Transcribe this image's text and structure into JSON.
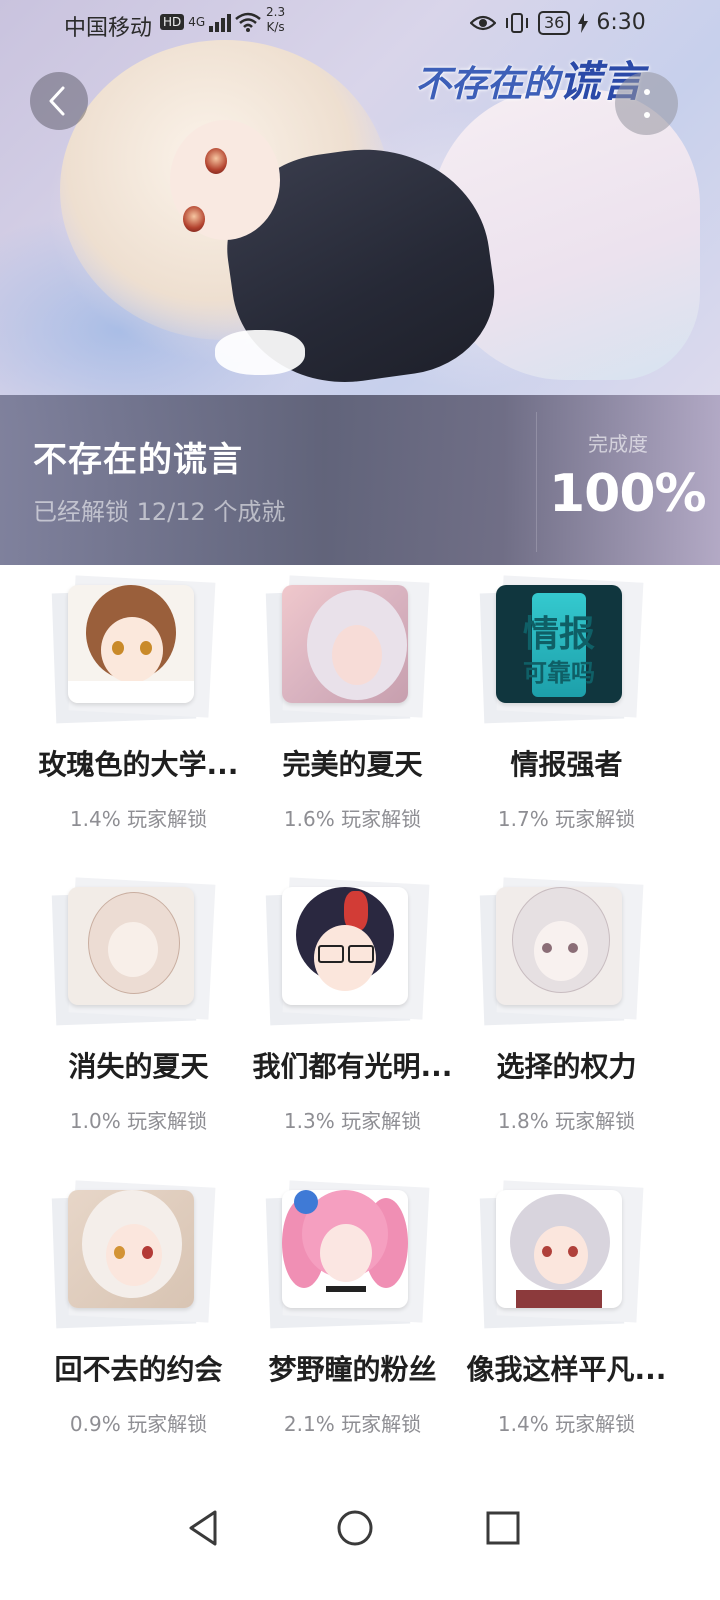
{
  "status_bar": {
    "carrier": "中国移动",
    "hd": "HD",
    "network": "4G",
    "speed_value": "2.3",
    "speed_unit": "K/s",
    "battery": "36",
    "time": "6:30"
  },
  "hero": {
    "logo_text_a": "不存在的",
    "logo_text_b": "谎言",
    "game_title": "不存在的谎言",
    "unlock_summary": "已经解锁 12/12 个成就",
    "completion_label": "完成度",
    "completion_value": "100%"
  },
  "achievements": [
    {
      "title": "玫瑰色的大学...",
      "rate": "1.4% 玩家解锁",
      "icon": "brown-hair-girl-portrait"
    },
    {
      "title": "完美的夏天",
      "rate": "1.6% 玩家解锁",
      "icon": "silver-hair-couple-portrait"
    },
    {
      "title": "情报强者",
      "rate": "1.7% 玩家解锁",
      "icon": "info-card",
      "icon_text_a": "情报",
      "icon_text_b": "可靠吗"
    },
    {
      "title": "消失的夏天",
      "rate": "1.0% 玩家解锁",
      "icon": "sketch-girl-portrait"
    },
    {
      "title": "我们都有光明...",
      "rate": "1.3% 玩家解锁",
      "icon": "glasses-boy-portrait"
    },
    {
      "title": "选择的权力",
      "rate": "1.8% 玩家解锁",
      "icon": "sketch-silver-girl-portrait"
    },
    {
      "title": "回不去的约会",
      "rate": "0.9% 玩家解锁",
      "icon": "white-hair-girl-portrait"
    },
    {
      "title": "梦野瞳的粉丝",
      "rate": "2.1% 玩家解锁",
      "icon": "pink-hair-girl-portrait"
    },
    {
      "title": "像我这样平凡...",
      "rate": "1.4% 玩家解锁",
      "icon": "silver-short-hair-girl-portrait"
    }
  ],
  "colors": {
    "accent_teal": "#1fc7cf",
    "text_primary": "#1f1f1f",
    "text_secondary": "#8e8e93"
  }
}
